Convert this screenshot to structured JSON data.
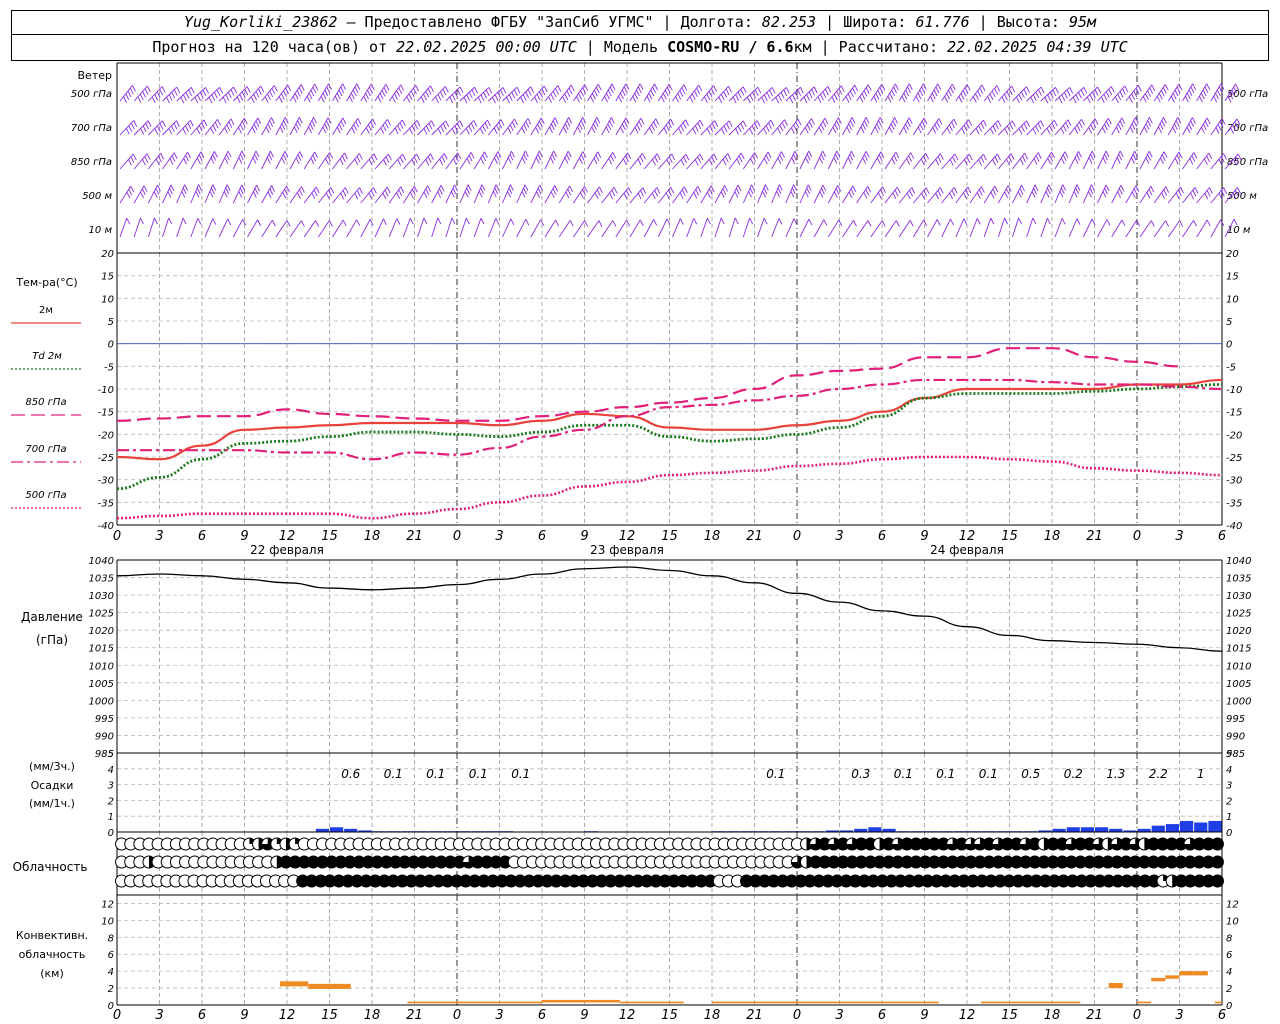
{
  "header": {
    "station": "Yug_Korliki_23862",
    "dash": " – ",
    "provider": "Предоставлено ФГБУ \"ЗапСиб УГМС\"",
    "sep": " | ",
    "lon_label": "Долгота: ",
    "lon": "82.253",
    "lat_label": "Широта: ",
    "lat": "61.776",
    "alt_label": "Высота: ",
    "alt": "95м",
    "forecast_label": "Прогноз на 120 часа(ов) от ",
    "forecast_start": "22.02.2025 00:00 UTC",
    "model_label": " | Модель ",
    "model": "COSMO-RU / 6.6",
    "model_unit": "км",
    "calc_label": " | Рассчитано: ",
    "calc_time": "22.02.2025 04:39 UTC"
  },
  "colors": {
    "t2m": "#e8423a",
    "td2m": "#1a7a1a",
    "t850": "#e0207a",
    "t700": "#e0207a",
    "t500": "#e0207a",
    "wind": "#8a2be2",
    "precip": "#1f3ee6",
    "convective": "#f08a24",
    "pressure": "#000000",
    "zero_line": "#3355cc"
  },
  "time_axis": {
    "hour_ticks": [
      "0",
      "3",
      "6",
      "9",
      "12",
      "15",
      "18",
      "21",
      "0",
      "3",
      "6",
      "9",
      "12",
      "15",
      "18",
      "21",
      "0",
      "3",
      "6",
      "9",
      "12",
      "15",
      "18",
      "21",
      "0",
      "3",
      "6"
    ],
    "day_labels": [
      {
        "hour": 12,
        "text": "22 февраля"
      },
      {
        "hour": 36,
        "text": "23 февраля"
      },
      {
        "hour": 60,
        "text": "24 февраля"
      }
    ],
    "day_lines_at": [
      0,
      24,
      48,
      72
    ]
  },
  "wind_panel": {
    "title": "Ветер",
    "levels": [
      "500 гПа",
      "700 гПа",
      "850 гПа",
      "500 м",
      "10  м"
    ]
  },
  "chart_data": [
    {
      "type": "line",
      "panel": "temperature",
      "title": "Тем-ра(°С)",
      "ylim": [
        -40,
        20
      ],
      "yticks": [
        20,
        15,
        10,
        5,
        0,
        -5,
        -10,
        -15,
        -20,
        -25,
        -30,
        -35,
        -40
      ],
      "x_unit": "hours from 22.02.2025 00:00 UTC",
      "x": [
        0,
        3,
        6,
        9,
        12,
        15,
        18,
        21,
        24,
        27,
        30,
        33,
        36,
        39,
        42,
        45,
        48,
        51,
        54,
        57,
        60,
        63,
        66,
        69,
        72,
        75,
        78
      ],
      "series": [
        {
          "name": "2м",
          "style": "solid",
          "values": [
            -25,
            -25.5,
            -22.5,
            -19,
            -18.5,
            -18,
            -17.5,
            -17.5,
            -17.5,
            -18,
            -17,
            -15.5,
            -16,
            -18.5,
            -19,
            -19,
            -18,
            -17,
            -15,
            -12,
            -10,
            -10,
            -10,
            -10,
            -9,
            -9,
            -8
          ]
        },
        {
          "name": "Td 2м",
          "style": "dotted",
          "values": [
            -32,
            -29.5,
            -25.5,
            -22,
            -21.5,
            -20.5,
            -19.5,
            -19.5,
            -20,
            -20.5,
            -19.5,
            -18,
            -18,
            -20.5,
            -21.5,
            -21,
            -20,
            -18.5,
            -16,
            -12,
            -11,
            -11,
            -11,
            -10.5,
            -10,
            -9.5,
            -9
          ]
        },
        {
          "name": "850 гПа",
          "style": "dashed",
          "values": [
            -17,
            -16.5,
            -16,
            -16,
            -14.5,
            -15.5,
            -16,
            -16.5,
            -17,
            -17,
            -16,
            -15,
            -14,
            -13,
            -12,
            -10,
            -7,
            -6,
            -5.5,
            -3,
            -3,
            -1,
            -1,
            -3,
            -4,
            -5
          ]
        },
        {
          "name": "700 гПа",
          "style": "dashdot",
          "values": [
            -23.5,
            -23.5,
            -23.5,
            -23.5,
            -24,
            -24,
            -25.5,
            -24,
            -24.5,
            -23,
            -20.5,
            -19,
            -16,
            -14,
            -13.5,
            -12.5,
            -11.5,
            -10,
            -9,
            -8,
            -8,
            -8,
            -8.5,
            -9,
            -9,
            -9.5,
            -10
          ]
        },
        {
          "name": "500 гПа",
          "style": "dotted",
          "values": [
            -38.5,
            -38,
            -37.5,
            -37.5,
            -37.5,
            -37.5,
            -38.5,
            -37.5,
            -36.5,
            -35,
            -33.5,
            -31.5,
            -30.5,
            -29,
            -28.5,
            -28,
            -27,
            -26.5,
            -25.5,
            -25,
            -25,
            -25.5,
            -26,
            -27.5,
            -28,
            -28.5,
            -29
          ]
        }
      ],
      "zero_line": true
    },
    {
      "type": "line",
      "panel": "pressure",
      "title": "Давление",
      "unit": "(гПа)",
      "ylim": [
        985,
        1040
      ],
      "yticks": [
        1040,
        1035,
        1030,
        1025,
        1020,
        1015,
        1010,
        1005,
        1000,
        995,
        990,
        985
      ],
      "x": [
        0,
        3,
        6,
        9,
        12,
        15,
        18,
        21,
        24,
        27,
        30,
        33,
        36,
        39,
        42,
        45,
        48,
        51,
        54,
        57,
        60,
        63,
        66,
        69,
        72,
        75,
        78
      ],
      "series": [
        {
          "name": "Давление",
          "values": [
            1035.5,
            1036,
            1035.5,
            1034.5,
            1033.5,
            1032,
            1031.5,
            1032,
            1033,
            1034.5,
            1036,
            1037.5,
            1038,
            1037,
            1035.5,
            1033.5,
            1030.5,
            1028,
            1025.5,
            1024,
            1021,
            1018.5,
            1017,
            1016.5,
            1016,
            1015,
            1014
          ]
        }
      ]
    },
    {
      "type": "bar",
      "panel": "precipitation",
      "title": "(мм/3ч.)",
      "subtitle": "Осадки",
      "ylabel": "(мм/1ч.)",
      "ylim": [
        0,
        5
      ],
      "yticks": [
        5,
        4,
        3,
        2,
        1,
        0
      ],
      "x_hourly": [
        15,
        16,
        17,
        18,
        19,
        20,
        21,
        22,
        23,
        24,
        25,
        26,
        27,
        28,
        29,
        30,
        31,
        32,
        33,
        34,
        35,
        36,
        37,
        38,
        39,
        40,
        41,
        42,
        43,
        44,
        45,
        46,
        47,
        48,
        49,
        50,
        51,
        52,
        53,
        54,
        55,
        56,
        57,
        58,
        59,
        60,
        61,
        62,
        63,
        64,
        65,
        66,
        67,
        68,
        69,
        70,
        71,
        72,
        73,
        74,
        75,
        76,
        77,
        78
      ],
      "values_hourly": [
        0.2,
        0.3,
        0.2,
        0.1,
        0.05,
        0.05,
        0.05,
        0.05,
        0.05,
        0.05,
        0.05,
        0.05,
        0.05,
        0.05,
        0,
        0,
        0,
        0,
        0,
        0.05,
        0,
        0,
        0,
        0,
        0,
        0,
        0,
        0,
        0.05,
        0.05,
        0.05,
        0.05,
        0.05,
        0.05,
        0.05,
        0.05,
        0.1,
        0.1,
        0.2,
        0.3,
        0.2,
        0.05,
        0.05,
        0.05,
        0.05,
        0.05,
        0.05,
        0.05,
        0.05,
        0.05,
        0.05,
        0.1,
        0.2,
        0.3,
        0.3,
        0.3,
        0.2,
        0.1,
        0.2,
        0.4,
        0.5,
        0.7,
        0.6,
        0.7,
        0.8,
        0.6,
        0.5,
        0.3
      ],
      "totals_3h": [
        {
          "hour": 18,
          "text": "0.6"
        },
        {
          "hour": 21,
          "text": "0.1"
        },
        {
          "hour": 24,
          "text": "0.1"
        },
        {
          "hour": 27,
          "text": "0.1"
        },
        {
          "hour": 30,
          "text": "0.1"
        },
        {
          "hour": 48,
          "text": "0.1"
        },
        {
          "hour": 54,
          "text": "0.3"
        },
        {
          "hour": 57,
          "text": "0.1"
        },
        {
          "hour": 60,
          "text": "0.1"
        },
        {
          "hour": 63,
          "text": "0.1"
        },
        {
          "hour": 66,
          "text": "0.5"
        },
        {
          "hour": 69,
          "text": "0.2"
        },
        {
          "hour": 72,
          "text": "1.3"
        },
        {
          "hour": 75,
          "text": "2.2"
        },
        {
          "hour": 78,
          "text": "1"
        }
      ]
    },
    {
      "type": "heatmap",
      "panel": "cloudiness",
      "title": "Облачность",
      "rows": [
        "upper",
        "middle",
        "lower"
      ],
      "values_upper": [
        0,
        0,
        0,
        0,
        0,
        0,
        0,
        0,
        0,
        0,
        0,
        0,
        0,
        0,
        0.25,
        0.5,
        0.75,
        0.25,
        0.5,
        0.25,
        0,
        0,
        0,
        0,
        0,
        0,
        0,
        0,
        0,
        0,
        0,
        0,
        0,
        0,
        0,
        0,
        0,
        0,
        0,
        0,
        0,
        0,
        0,
        0,
        0,
        0,
        0,
        0,
        0,
        0,
        0,
        0,
        0,
        0,
        0,
        0,
        0,
        0,
        0,
        0,
        0,
        0,
        0,
        0,
        0,
        0,
        0,
        0,
        0,
        0,
        0,
        0,
        0,
        0,
        0,
        0.5,
        0.75,
        1,
        0.75,
        1,
        0.75,
        1,
        1,
        0.5,
        1,
        0.75,
        1,
        1,
        1,
        1,
        1,
        0.75,
        1,
        0.75,
        0.75,
        1,
        0.75,
        1,
        1,
        0.75,
        1,
        0.5,
        1,
        1,
        0.75,
        1,
        1,
        0.75,
        0.5,
        0.75,
        1,
        0.75,
        0.5,
        1,
        1,
        1,
        1,
        0.75,
        1,
        1,
        1
      ],
      "values_middle": [
        0,
        0,
        0,
        0.5,
        0,
        0,
        0,
        0,
        0,
        0,
        0,
        0,
        0,
        0,
        0,
        0,
        0,
        0.5,
        1,
        1,
        1,
        1,
        1,
        1,
        1,
        1,
        1,
        1,
        1,
        1,
        1,
        1,
        1,
        1,
        1,
        1,
        1,
        1,
        0.75,
        1,
        1,
        1,
        1,
        0,
        0,
        0,
        0,
        0,
        0,
        0,
        0,
        0,
        0,
        0,
        0,
        0,
        0,
        0,
        0,
        0,
        0,
        0,
        0,
        0,
        0,
        0,
        0,
        0,
        0,
        0,
        0,
        0,
        0,
        0,
        0.75,
        0.5,
        1,
        1,
        1,
        1,
        1,
        1,
        1,
        1,
        1,
        1,
        1,
        1,
        1,
        1,
        1,
        1,
        1,
        1,
        1,
        1,
        1,
        1,
        1,
        1,
        1,
        1,
        1,
        1,
        1,
        1,
        1,
        1,
        1,
        1,
        1,
        1,
        1,
        1,
        1,
        1,
        1,
        1,
        1,
        1,
        1
      ],
      "values_lower": [
        0,
        0,
        0,
        0,
        0,
        0,
        0,
        0,
        0,
        0,
        0,
        0,
        0,
        0,
        0,
        0,
        0,
        0,
        0,
        0,
        1,
        1,
        1,
        1,
        1,
        1,
        1,
        1,
        1,
        1,
        1,
        1,
        1,
        1,
        1,
        1,
        1,
        1,
        1,
        1,
        1,
        1,
        1,
        1,
        1,
        1,
        1,
        1,
        1,
        1,
        1,
        1,
        1,
        1,
        1,
        1,
        1,
        1,
        1,
        1,
        1,
        1,
        1,
        1,
        1,
        1,
        0,
        0,
        0,
        1,
        1,
        1,
        1,
        1,
        1,
        1,
        1,
        1,
        1,
        1,
        1,
        1,
        1,
        1,
        1,
        1,
        1,
        1,
        1,
        1,
        1,
        1,
        1,
        1,
        1,
        1,
        1,
        1,
        1,
        1,
        1,
        1,
        1,
        1,
        1,
        1,
        1,
        1,
        1,
        1,
        1,
        1,
        1,
        1,
        1,
        0.25,
        0.5,
        1,
        1,
        1,
        1,
        1
      ]
    },
    {
      "type": "bar",
      "panel": "convective",
      "title": "Конвективн.",
      "subtitle": "облачность",
      "ylabel": "(км)",
      "ylim": [
        0,
        13
      ],
      "yticks": [
        12,
        10,
        8,
        6,
        4,
        2,
        0
      ],
      "segments": [
        {
          "from": 11.5,
          "to": 13.5,
          "base": 2.2,
          "top": 2.8
        },
        {
          "from": 13.5,
          "to": 16.5,
          "base": 1.9,
          "top": 2.5
        },
        {
          "from": 20.5,
          "to": 30,
          "base": 0.2,
          "top": 0.4
        },
        {
          "from": 30,
          "to": 35.5,
          "base": 0.3,
          "top": 0.6
        },
        {
          "from": 35.5,
          "to": 40,
          "base": 0.2,
          "top": 0.4
        },
        {
          "from": 42,
          "to": 58,
          "base": 0.2,
          "top": 0.4
        },
        {
          "from": 61,
          "to": 68,
          "base": 0.2,
          "top": 0.4
        },
        {
          "from": 70,
          "to": 71,
          "base": 2.0,
          "top": 2.6
        },
        {
          "from": 72,
          "to": 73,
          "base": 0.2,
          "top": 0.4
        },
        {
          "from": 73,
          "to": 74,
          "base": 2.8,
          "top": 3.2
        },
        {
          "from": 74,
          "to": 75,
          "base": 3.1,
          "top": 3.5
        },
        {
          "from": 75,
          "to": 77,
          "base": 3.5,
          "top": 4.0
        },
        {
          "from": 77.5,
          "to": 78,
          "base": 0.2,
          "top": 0.4
        }
      ]
    }
  ],
  "wind_barbs": {
    "hours_step": 1,
    "dir_500hpa": 250,
    "dir_700hpa": 240,
    "dir_850hpa": 230,
    "dir_500m": 220,
    "dir_10m": 200,
    "speed_knots_500hpa": 45,
    "speed_knots_700hpa": 35,
    "speed_knots_850hpa": 30,
    "speed_knots_500m": 25,
    "speed_knots_10m": 10
  }
}
